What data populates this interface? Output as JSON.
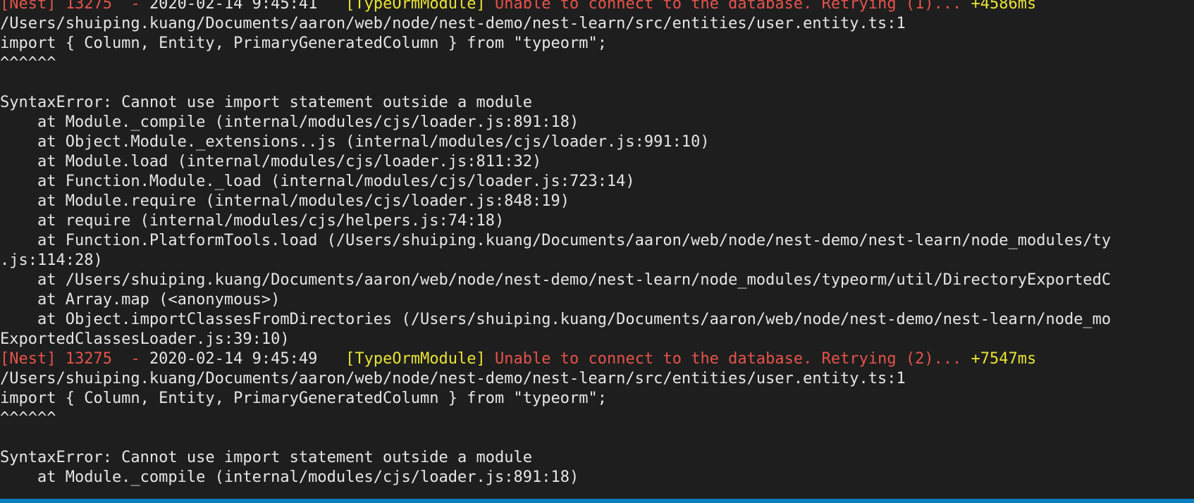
{
  "terminal": {
    "lines": [
      {
        "type": "nest",
        "prefix": "[Nest] 13275",
        "sep": "  - ",
        "date": "2020-02-14 9:45:41",
        "module": "[TypeOrmModule]",
        "message": "Unable to connect to the database. Retrying (1)...",
        "elapsed": "+4586ms"
      },
      {
        "type": "plain",
        "text": "/Users/shuiping.kuang/Documents/aaron/web/node/nest-demo/nest-learn/src/entities/user.entity.ts:1"
      },
      {
        "type": "plain",
        "text": "import { Column, Entity, PrimaryGeneratedColumn } from \"typeorm\";"
      },
      {
        "type": "plain",
        "text": "^^^^^^"
      },
      {
        "type": "plain",
        "text": ""
      },
      {
        "type": "plain",
        "text": "SyntaxError: Cannot use import statement outside a module"
      },
      {
        "type": "plain",
        "text": "    at Module._compile (internal/modules/cjs/loader.js:891:18)"
      },
      {
        "type": "plain",
        "text": "    at Object.Module._extensions..js (internal/modules/cjs/loader.js:991:10)"
      },
      {
        "type": "plain",
        "text": "    at Module.load (internal/modules/cjs/loader.js:811:32)"
      },
      {
        "type": "plain",
        "text": "    at Function.Module._load (internal/modules/cjs/loader.js:723:14)"
      },
      {
        "type": "plain",
        "text": "    at Module.require (internal/modules/cjs/loader.js:848:19)"
      },
      {
        "type": "plain",
        "text": "    at require (internal/modules/cjs/helpers.js:74:18)"
      },
      {
        "type": "plain",
        "text": "    at Function.PlatformTools.load (/Users/shuiping.kuang/Documents/aaron/web/node/nest-demo/nest-learn/node_modules/ty"
      },
      {
        "type": "plain",
        "text": ".js:114:28)"
      },
      {
        "type": "plain",
        "text": "    at /Users/shuiping.kuang/Documents/aaron/web/node/nest-demo/nest-learn/node_modules/typeorm/util/DirectoryExportedC"
      },
      {
        "type": "plain",
        "text": "    at Array.map (<anonymous>)"
      },
      {
        "type": "plain",
        "text": "    at Object.importClassesFromDirectories (/Users/shuiping.kuang/Documents/aaron/web/node/nest-demo/nest-learn/node_mo"
      },
      {
        "type": "plain",
        "text": "ExportedClassesLoader.js:39:10)"
      },
      {
        "type": "nest",
        "prefix": "[Nest] 13275",
        "sep": "  - ",
        "date": "2020-02-14 9:45:49",
        "module": "[TypeOrmModule]",
        "message": "Unable to connect to the database. Retrying (2)...",
        "elapsed": "+7547ms"
      },
      {
        "type": "plain",
        "text": "/Users/shuiping.kuang/Documents/aaron/web/node/nest-demo/nest-learn/src/entities/user.entity.ts:1"
      },
      {
        "type": "plain",
        "text": "import { Column, Entity, PrimaryGeneratedColumn } from \"typeorm\";"
      },
      {
        "type": "plain",
        "text": "^^^^^^"
      },
      {
        "type": "plain",
        "text": ""
      },
      {
        "type": "plain",
        "text": "SyntaxError: Cannot use import statement outside a module"
      },
      {
        "type": "plain",
        "text": "    at Module._compile (internal/modules/cjs/loader.js:891:18)"
      }
    ]
  },
  "colors": {
    "background": "#1e1e1e",
    "text": "#e6e6e6",
    "nest_red": "#e5534b",
    "yellow": "#e8e335",
    "status_bar": "#0e7fc0"
  }
}
